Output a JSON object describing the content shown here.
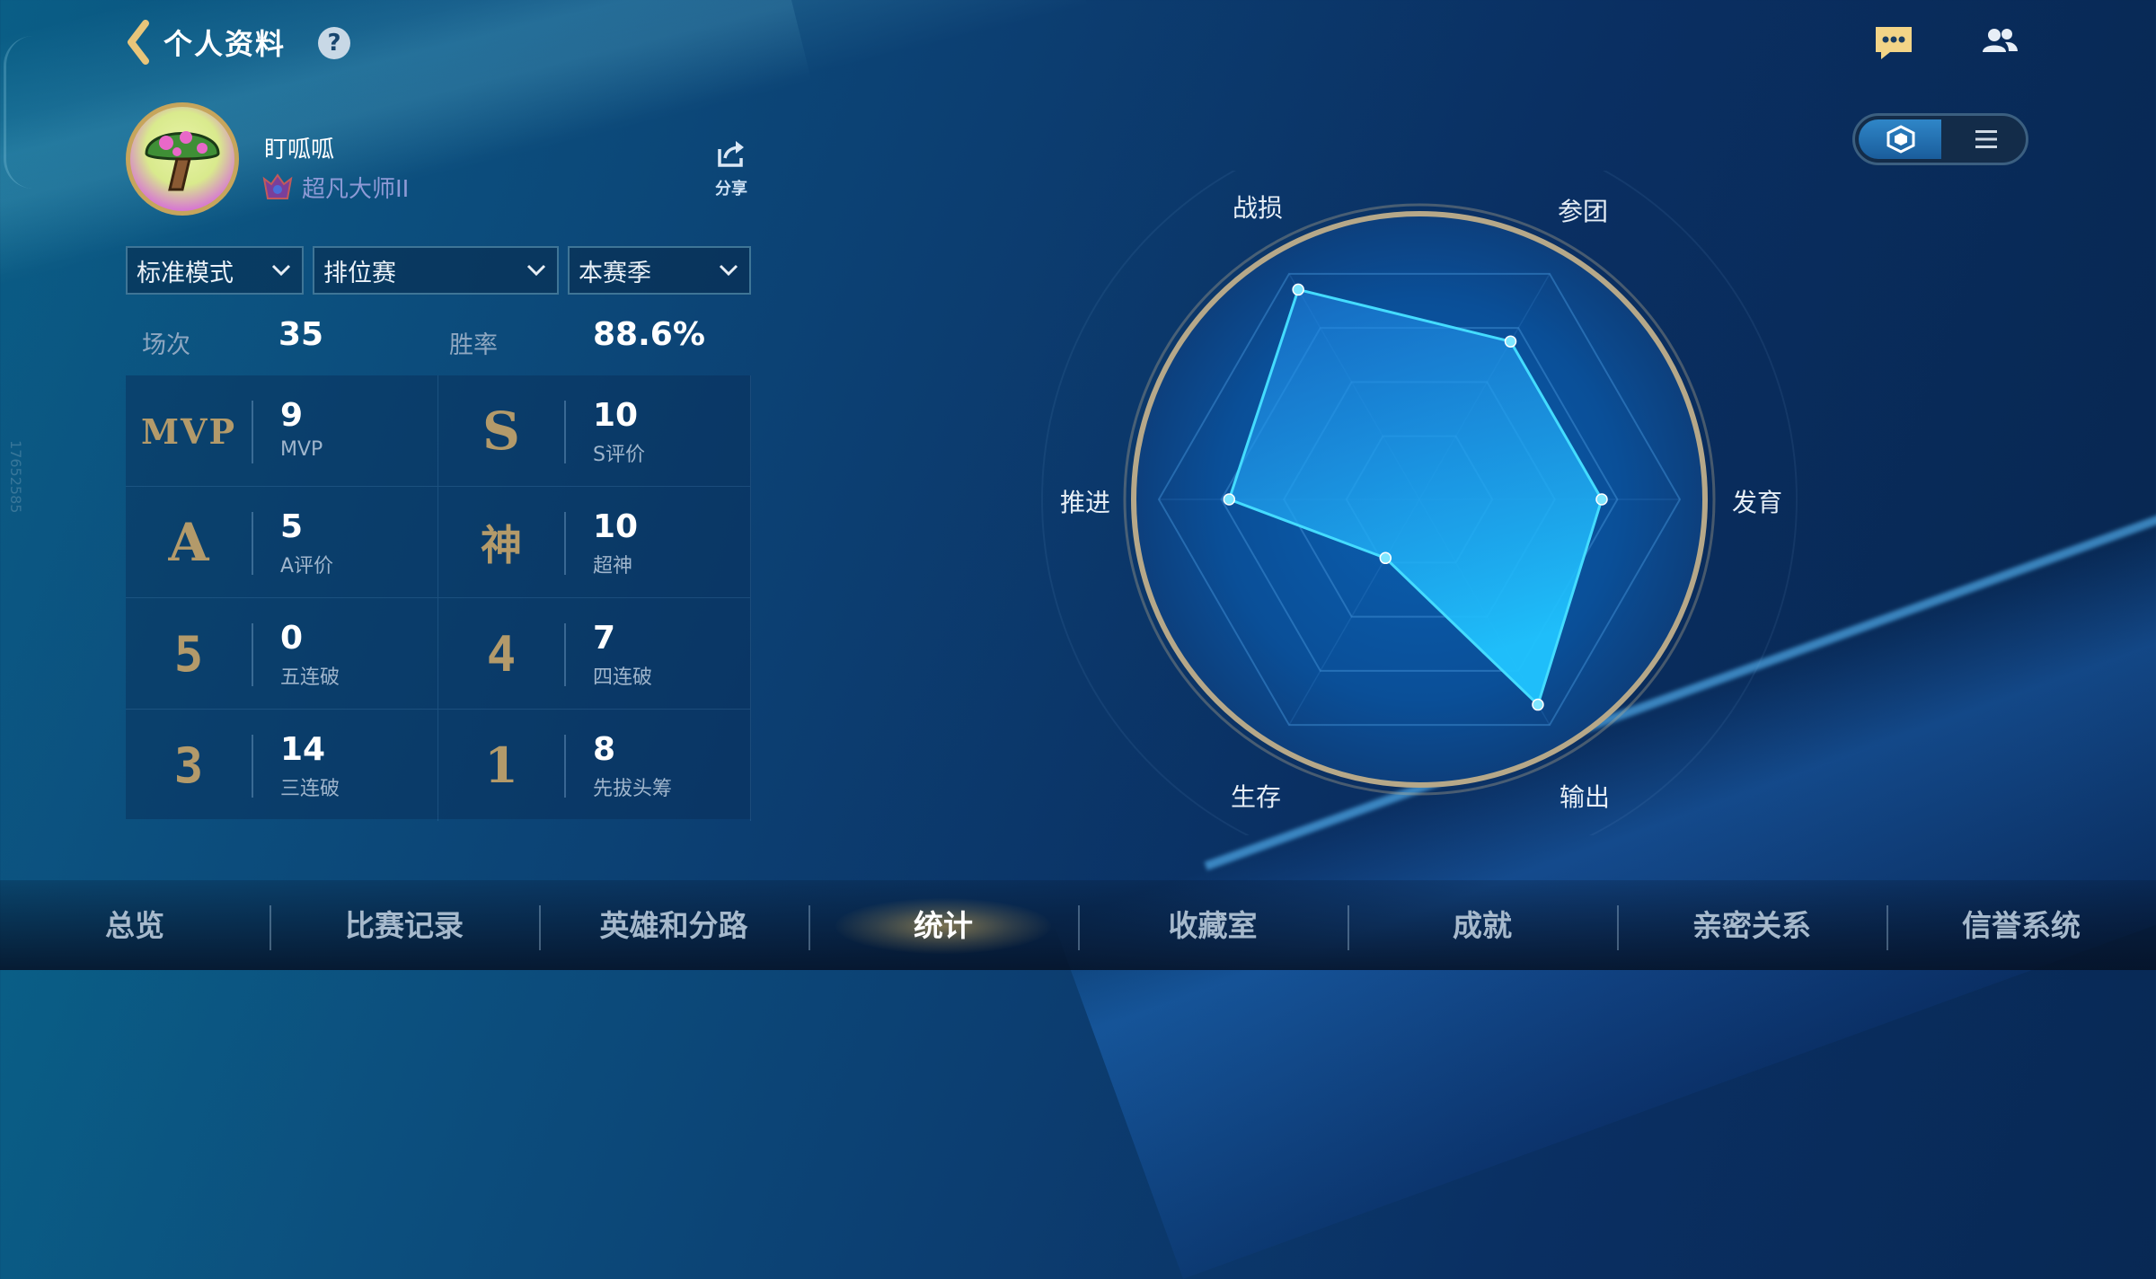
{
  "header": {
    "title": "个人资料",
    "help_icon": "?",
    "icons": [
      "chat-icon",
      "friends-icon"
    ]
  },
  "profile": {
    "nickname": "盯呱呱",
    "rank": "超凡大师II",
    "share_label": "分享",
    "side_id": "17652585"
  },
  "filters": [
    {
      "label": "标准模式"
    },
    {
      "label": "排位赛"
    },
    {
      "label": "本赛季"
    }
  ],
  "summary": {
    "matches_label": "场次",
    "matches_value": "35",
    "winrate_label": "胜率",
    "winrate_value": "88.6%"
  },
  "stats": [
    {
      "badge": "MVP",
      "value": "9",
      "caption": "MVP"
    },
    {
      "badge": "S",
      "value": "10",
      "caption": "S评价"
    },
    {
      "badge": "A",
      "value": "5",
      "caption": "A评价"
    },
    {
      "badge": "神",
      "value": "10",
      "caption": "超神"
    },
    {
      "badge": "5",
      "value": "0",
      "caption": "五连破"
    },
    {
      "badge": "4",
      "value": "7",
      "caption": "四连破"
    },
    {
      "badge": "3",
      "value": "14",
      "caption": "三连破"
    },
    {
      "badge": "1",
      "value": "8",
      "caption": "先拔头筹"
    }
  ],
  "radar": {
    "axes": [
      "战损",
      "参团",
      "发育",
      "输出",
      "生存",
      "推进"
    ],
    "values": [
      0.93,
      0.7,
      0.7,
      0.91,
      0.26,
      0.73
    ],
    "color": "#22c8ff"
  },
  "nav": {
    "tabs": [
      "总览",
      "比赛记录",
      "英雄和分路",
      "统计",
      "收藏室",
      "成就",
      "亲密关系",
      "信誉系统"
    ],
    "active": "统计"
  },
  "colors": {
    "accent_gold": "#c6a55c",
    "radar_stroke": "#3fd9ff"
  }
}
